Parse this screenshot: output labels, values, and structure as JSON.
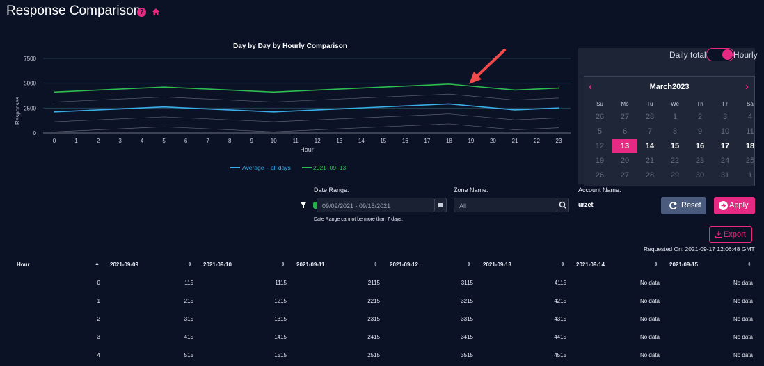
{
  "page": {
    "title": "Response Comparison"
  },
  "icons": {
    "help": "question-circle-icon",
    "home": "home-icon",
    "accent": "#e62a83"
  },
  "chart_data": {
    "type": "line",
    "title": "Day by Day by Hourly Comparison",
    "xlabel": "Hour",
    "ylabel": "Responses",
    "x_ticks": [
      "0",
      "1",
      "2",
      "3",
      "4",
      "5",
      "6",
      "7",
      "8",
      "9",
      "10",
      "11",
      "12",
      "13",
      "14",
      "15",
      "16",
      "17",
      "18",
      "19",
      "20",
      "21",
      "22",
      "23"
    ],
    "y_ticks": [
      "0",
      "2500",
      "5000",
      "7500"
    ],
    "ylim": [
      0,
      7500
    ],
    "xlim": [
      0,
      23
    ],
    "grid": true,
    "legend_placement": "bottom-center",
    "series": [
      {
        "name": "Average – all days",
        "color": "#3aaee8",
        "x": [
          0,
          5,
          10,
          18,
          21,
          23
        ],
        "y": [
          2115,
          2615,
          2115,
          2915,
          2315,
          2515
        ]
      },
      {
        "name": "2021–09–13",
        "color": "#2ebd4f",
        "x": [
          0,
          5,
          10,
          18,
          21,
          23
        ],
        "y": [
          4115,
          4615,
          4115,
          4915,
          4315,
          4515
        ]
      },
      {
        "color": "#5d6270",
        "x": [
          0,
          5,
          10,
          18,
          21,
          23
        ],
        "y": [
          115,
          615,
          115,
          915,
          315,
          515
        ]
      },
      {
        "color": "#5d6270",
        "x": [
          0,
          5,
          10,
          18,
          21,
          23
        ],
        "y": [
          1115,
          1615,
          1115,
          1915,
          1315,
          1515
        ]
      },
      {
        "color": "#5d6270",
        "x": [
          0,
          5,
          10,
          18,
          21,
          23
        ],
        "y": [
          2115,
          2615,
          2115,
          2915,
          2315,
          2515
        ]
      },
      {
        "color": "#5d6270",
        "x": [
          0,
          5,
          10,
          18,
          21,
          23
        ],
        "y": [
          3115,
          3615,
          3115,
          3915,
          3315,
          3515
        ]
      }
    ]
  },
  "toggle": {
    "left_label": "Daily total",
    "right_label": "Hourly",
    "state": "Hourly"
  },
  "calendar": {
    "title": "March2023",
    "prev": "‹",
    "next": "›",
    "weekdays": [
      "Su",
      "Mo",
      "Tu",
      "We",
      "Th",
      "Fr",
      "Sa"
    ],
    "days": [
      [
        "26",
        "27",
        "28",
        "1",
        "2",
        "3",
        "4"
      ],
      [
        "5",
        "6",
        "7",
        "8",
        "9",
        "10",
        "11"
      ],
      [
        "12",
        "13",
        "14",
        "15",
        "16",
        "17",
        "18"
      ],
      [
        "19",
        "20",
        "21",
        "22",
        "23",
        "24",
        "25"
      ],
      [
        "26",
        "27",
        "28",
        "29",
        "30",
        "31",
        "1"
      ]
    ],
    "selected": "13"
  },
  "filters": {
    "date_range_label": "Date Range:",
    "date_range_value": "09/09/2021 - 09/15/2021",
    "date_range_hint": "Date Range cannot be more than 7 days.",
    "zone_label": "Zone Name:",
    "zone_placeholder": "All",
    "account_label": "Account Name:",
    "account_value": "urzet"
  },
  "buttons": {
    "reset": "Reset",
    "apply": "Apply",
    "export": "Export"
  },
  "requested_on": "Requested On: 2021-09-17 12:06:48 GMT",
  "table": {
    "columns": [
      "Hour",
      "2021-09-09",
      "2021-09-10",
      "2021-09-11",
      "2021-09-12",
      "2021-09-13",
      "2021-09-14",
      "2021-09-15"
    ],
    "rows": [
      [
        "0",
        "115",
        "1115",
        "2115",
        "3115",
        "4115",
        "No data",
        "No data"
      ],
      [
        "1",
        "215",
        "1215",
        "2215",
        "3215",
        "4215",
        "No data",
        "No data"
      ],
      [
        "2",
        "315",
        "1315",
        "2315",
        "3315",
        "4315",
        "No data",
        "No data"
      ],
      [
        "3",
        "415",
        "1415",
        "2415",
        "3415",
        "4415",
        "No data",
        "No data"
      ],
      [
        "4",
        "515",
        "1515",
        "2515",
        "3515",
        "4515",
        "No data",
        "No data"
      ]
    ]
  }
}
